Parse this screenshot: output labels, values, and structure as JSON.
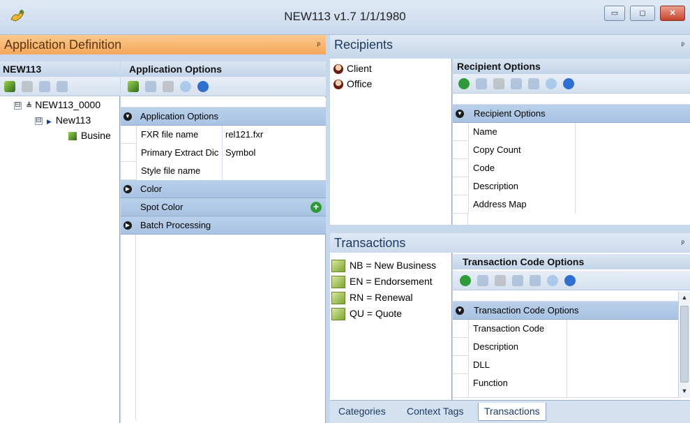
{
  "window": {
    "title": "NEW113 v1.7 1/1/1980",
    "buttons": {
      "minimize": "▭",
      "restore": "◻",
      "close": "✕"
    }
  },
  "app_definition": {
    "header": "Application Definition",
    "pin": "ᵖ",
    "tree_title": "NEW113",
    "tree": [
      {
        "label": "NEW113_0000",
        "expander": "⊟"
      },
      {
        "label": "New113",
        "expander": "⊟"
      },
      {
        "label": "Busine",
        "expander": ""
      }
    ],
    "options_title": "Application Options",
    "grid": {
      "cat_app": "Application Options",
      "fxr_label": "FXR file name",
      "fxr_value": "rel121.fxr",
      "pri_label": "Primary Extract Dic",
      "pri_value": "Symbol",
      "style_label": "Style file name",
      "style_value": "",
      "cat_color": "Color",
      "spot_label": "Spot Color",
      "cat_batch": "Batch Processing"
    }
  },
  "recipients": {
    "header": "Recipients",
    "pin": "ᵖ",
    "items": [
      "Client",
      "Office"
    ],
    "options_title": "Recipient Options",
    "grid": {
      "cat": "Recipient Options",
      "rows": [
        "Name",
        "Copy Count",
        "Code",
        "Description",
        "Address Map"
      ]
    }
  },
  "transactions": {
    "header": "Transactions",
    "pin": "ᵖ",
    "items": [
      "NB = New Business",
      "EN = Endorsement",
      "RN = Renewal",
      "QU = Quote"
    ],
    "options_title": "Transaction Code Options",
    "grid": {
      "cat": "Transaction Code Options",
      "rows": [
        "Transaction Code",
        "Description",
        "DLL",
        "Function"
      ]
    }
  },
  "tabs": [
    "Categories",
    "Context Tags",
    "Transactions"
  ],
  "active_tab": "Transactions",
  "colors": {
    "accent_orange": "#f5a75a",
    "category_blue": "#a8c3e3",
    "add_green": "#2e9b3a"
  }
}
